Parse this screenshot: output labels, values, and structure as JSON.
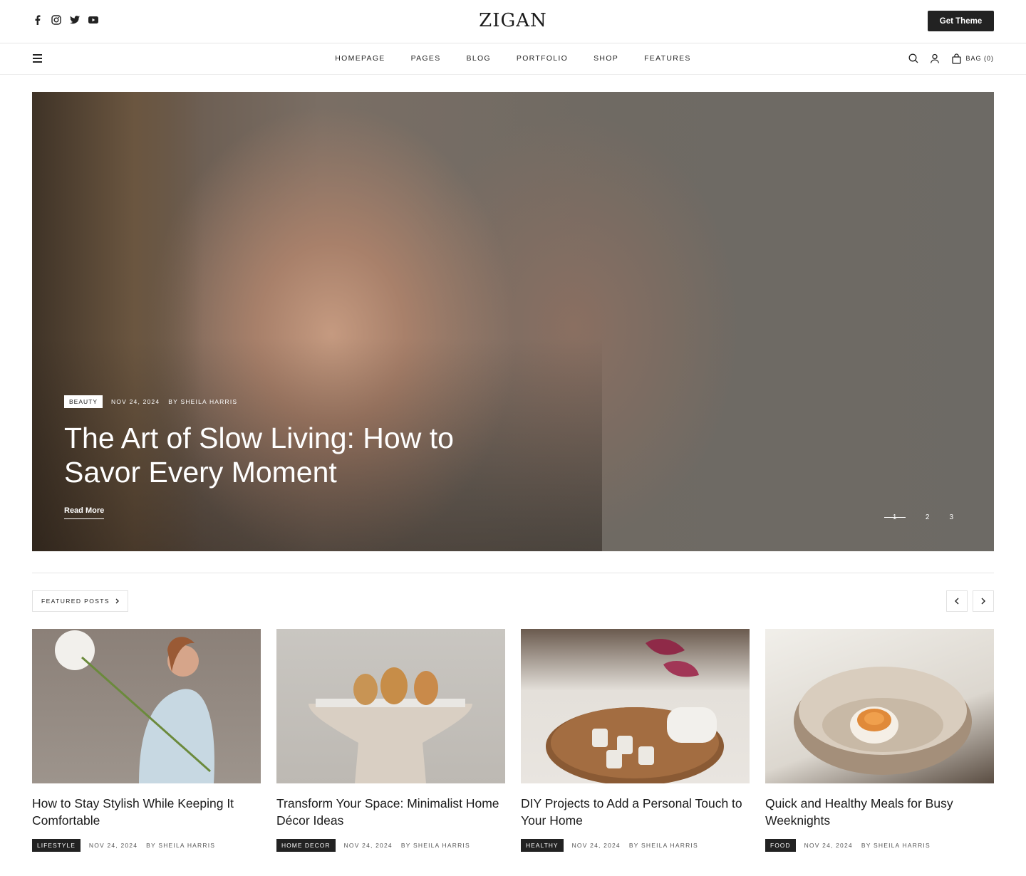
{
  "header": {
    "logo": "ZIGAN",
    "get_theme": "Get Theme",
    "social_icons": [
      "facebook-icon",
      "instagram-icon",
      "twitter-icon",
      "youtube-icon"
    ]
  },
  "nav": {
    "items": [
      "HOMEPAGE",
      "PAGES",
      "BLOG",
      "PORTFOLIO",
      "SHOP",
      "FEATURES"
    ],
    "bag_label": "BAG (0)"
  },
  "hero": {
    "category": "BEAUTY",
    "date": "NOV 24, 2024",
    "author": "BY SHEILA HARRIS",
    "title": "The Art of Slow Living: How to Savor Every Moment",
    "read_more": "Read More",
    "pages": [
      "1",
      "2",
      "3"
    ]
  },
  "featured": {
    "label": "FEATURED POSTS",
    "cards": [
      {
        "title": "How to Stay Stylish While Keeping It Comfortable",
        "category": "LIFESTYLE",
        "date": "NOV 24, 2024",
        "author": "BY SHEILA HARRIS"
      },
      {
        "title": "Transform Your Space: Minimalist Home Décor Ideas",
        "category": "HOME DECOR",
        "date": "NOV 24, 2024",
        "author": "BY SHEILA HARRIS"
      },
      {
        "title": "DIY Projects to Add a Personal Touch to Your Home",
        "category": "HEALTHY",
        "date": "NOV 24, 2024",
        "author": "BY SHEILA HARRIS"
      },
      {
        "title": "Quick and Healthy Meals for Busy Weeknights",
        "category": "FOOD",
        "date": "NOV 24, 2024",
        "author": "BY SHEILA HARRIS"
      }
    ]
  },
  "colors": {
    "dark": "#222222",
    "border": "#e6e6e6"
  }
}
